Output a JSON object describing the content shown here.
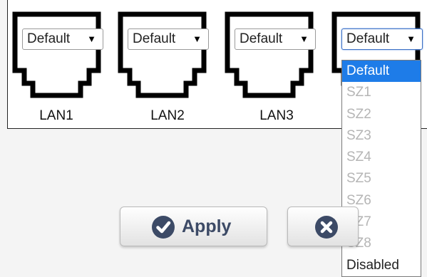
{
  "ports": [
    {
      "label": "LAN1",
      "value": "Default"
    },
    {
      "label": "LAN2",
      "value": "Default"
    },
    {
      "label": "LAN3",
      "value": "Default"
    },
    {
      "label": "",
      "value": "Default"
    }
  ],
  "dropdown": {
    "options": [
      "Default",
      "SZ1",
      "SZ2",
      "SZ3",
      "SZ4",
      "SZ5",
      "SZ6",
      "SZ7",
      "SZ8",
      "Disabled"
    ],
    "selected": "Default"
  },
  "buttons": {
    "apply_label": "Apply",
    "cancel_label": ""
  },
  "colors": {
    "accent": "#1e7ce8",
    "button_text": "#3c4a66",
    "disabled_option": "#b5b5b5"
  }
}
